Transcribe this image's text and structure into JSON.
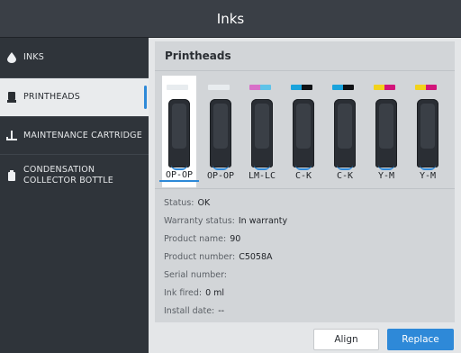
{
  "window": {
    "title": "Inks"
  },
  "sidebar": {
    "items": [
      {
        "label": "INKS",
        "icon": "ink-drop-icon",
        "active": false
      },
      {
        "label": "PRINTHEADS",
        "icon": "printhead-icon",
        "active": true
      },
      {
        "label": "MAINTENANCE CARTRIDGE",
        "icon": "maintenance-cartridge-icon",
        "active": false
      },
      {
        "label": "CONDENSATION COLLECTOR BOTTLE",
        "icon": "bottle-icon",
        "active": false
      }
    ]
  },
  "panel": {
    "title": "Printheads",
    "printheads": [
      {
        "label": "OP-OP",
        "chip_colors": [
          "#e8ecef",
          "#e8ecef"
        ],
        "selected": true
      },
      {
        "label": "OP-OP",
        "chip_colors": [
          "#e8ecef",
          "#e8ecef"
        ],
        "selected": false
      },
      {
        "label": "LM-LC",
        "chip_colors": [
          "#d870c8",
          "#5fc3e8"
        ],
        "selected": false
      },
      {
        "label": "C-K",
        "chip_colors": [
          "#1aa3dc",
          "#101215"
        ],
        "selected": false
      },
      {
        "label": "C-K",
        "chip_colors": [
          "#1aa3dc",
          "#101215"
        ],
        "selected": false
      },
      {
        "label": "Y-M",
        "chip_colors": [
          "#f2d21c",
          "#d2157a"
        ],
        "selected": false
      },
      {
        "label": "Y-M",
        "chip_colors": [
          "#f2d21c",
          "#d2157a"
        ],
        "selected": false
      }
    ],
    "details": [
      {
        "key": "Status:",
        "value": "OK"
      },
      {
        "key": "Warranty status:",
        "value": "In warranty"
      },
      {
        "key": "Product name:",
        "value": "90"
      },
      {
        "key": "Product number:",
        "value": "C5058A"
      },
      {
        "key": "Serial number:",
        "value": ""
      },
      {
        "key": "Ink fired:",
        "value": "0 ml"
      },
      {
        "key": "Install date:",
        "value": "--"
      }
    ]
  },
  "actions": {
    "align_label": "Align",
    "replace_label": "Replace"
  },
  "colors": {
    "accent": "#2e89d8",
    "sidebar_bg": "#2f343a",
    "title_bg": "#3a3f46"
  }
}
